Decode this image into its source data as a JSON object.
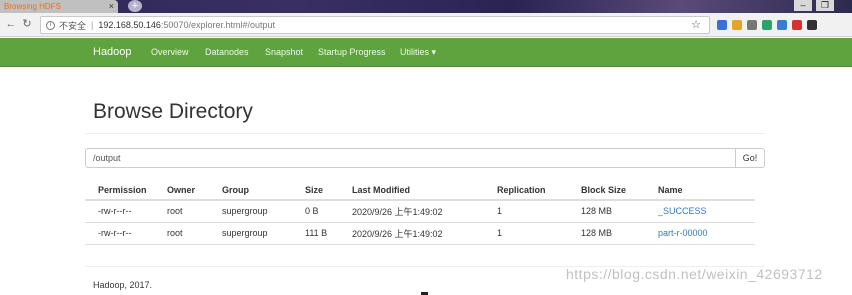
{
  "browser": {
    "tab_title": "Browsing HDFS",
    "tab_close": "×",
    "new_tab": "+",
    "window_buttons": [
      "–",
      "❐"
    ],
    "security_label": "不安全",
    "address_sep": "|",
    "url_host": "192.168.50.146",
    "url_rest": ":50070/explorer.html#/output",
    "extension_colors": [
      "#3b6fd6",
      "#e4a32a",
      "#777777",
      "#2aa36b",
      "#3a7bd5",
      "#d23434",
      "#333333"
    ]
  },
  "navbar": {
    "brand": "Hadoop",
    "items": [
      {
        "label": "Overview"
      },
      {
        "label": "Datanodes"
      },
      {
        "label": "Snapshot"
      },
      {
        "label": "Startup Progress"
      },
      {
        "label": "Utilities ▾"
      }
    ],
    "color": "#5fa33e"
  },
  "page": {
    "title": "Browse Directory",
    "path_value": "/output",
    "go_label": "Go!"
  },
  "table": {
    "columns": [
      "Permission",
      "Owner",
      "Group",
      "Size",
      "Last Modified",
      "Replication",
      "Block Size",
      "Name"
    ],
    "rows": [
      [
        "-rw-r--r--",
        "root",
        "supergroup",
        "0 B",
        "2020/9/26 上午1:49:02",
        "1",
        "128 MB",
        "_SUCCESS"
      ],
      [
        "-rw-r--r--",
        "root",
        "supergroup",
        "111 B",
        "2020/9/26 上午1:49:02",
        "1",
        "128 MB",
        "part-r-00000"
      ]
    ]
  },
  "footer": {
    "text": "Hadoop, 2017.",
    "watermark": "https://blog.csdn.net/weixin_42693712"
  }
}
